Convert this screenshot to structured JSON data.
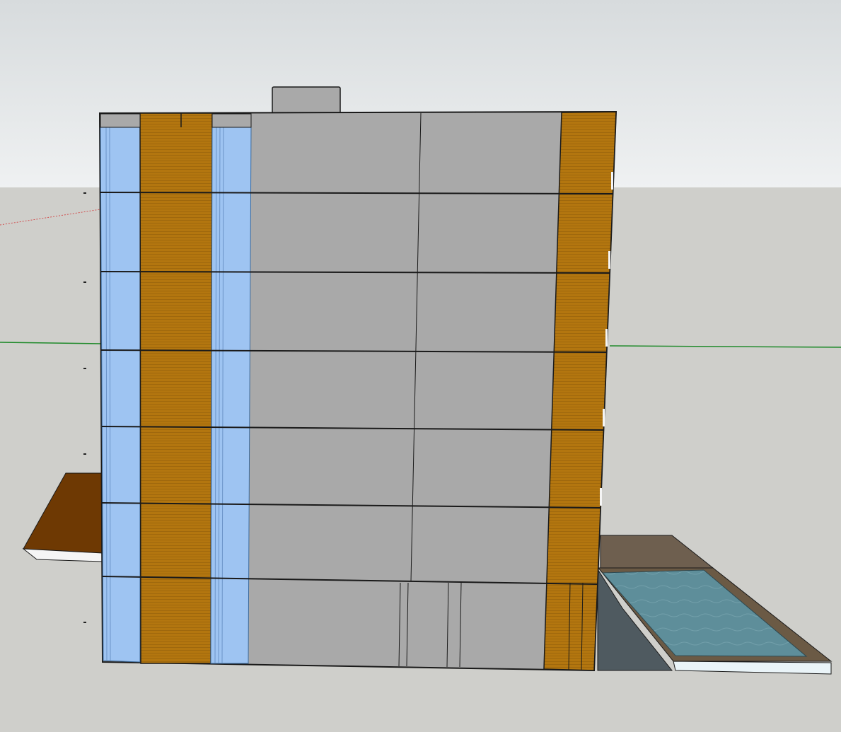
{
  "viewport": {
    "sky_top_color": "#d7dbdd",
    "sky_bottom_color": "#eff1f2",
    "ground_color": "#cfcfcb",
    "green_axis_color": "#1f8a2a",
    "red_axis_color": "#d05050"
  },
  "building": {
    "floors": 7,
    "concrete_color": "#a9a9a9",
    "wood_color": "#b3760f",
    "glass_color": "#9ec4f2",
    "edge_color": "#1a1a1a"
  },
  "deck_left": {
    "top_color": "#6e3903",
    "edge_color": "#f5f5f5"
  },
  "pool": {
    "deck_color": "#6e5f4f",
    "water_color": "#5e8e9a",
    "rim_color": "#6b5a45",
    "side_color": "#4f5a60",
    "edge_color": "#eaf4f8"
  },
  "rooftop": {
    "color": "#a9a9a9"
  }
}
